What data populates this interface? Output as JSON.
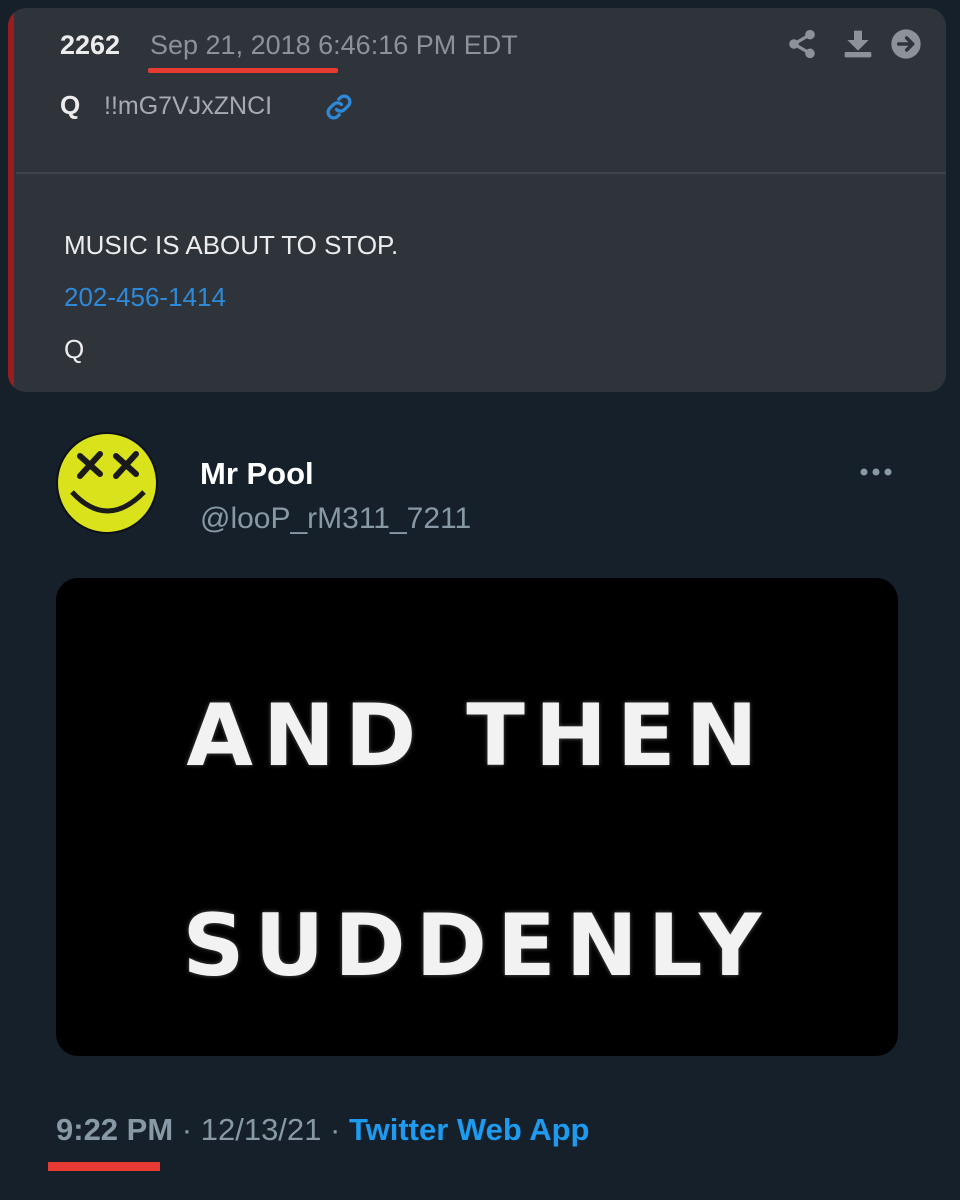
{
  "qpost": {
    "post_number": "2262",
    "date": "Sep 21, 2018 6:46:16 PM EDT",
    "author": "Q",
    "tripcode": "!!mG7VJxZNCI",
    "lines": [
      {
        "text": "MUSIC IS ABOUT TO STOP.",
        "kind": "text"
      },
      {
        "text": "202-456-1414",
        "kind": "phone"
      },
      {
        "text": "Q",
        "kind": "text"
      }
    ],
    "icons": [
      "share-icon",
      "download-icon",
      "forward-icon",
      "link-icon"
    ],
    "colors": {
      "accent": "#9b1c1c",
      "link": "#2e8ad8",
      "highlight": "#e63a32"
    }
  },
  "tweet": {
    "display_name": "Mr Pool",
    "handle": "@looP_rM311_7211",
    "media_lines": [
      "AND THEN",
      "SUDDENLY"
    ],
    "time": "9:22 PM",
    "separator": " · ",
    "date": "12/13/21",
    "source": "Twitter Web App",
    "icons": [
      "avatar",
      "more-icon"
    ],
    "colors": {
      "background": "#15202b",
      "source_link": "#1d9bf0",
      "highlight": "#e63a32"
    }
  }
}
